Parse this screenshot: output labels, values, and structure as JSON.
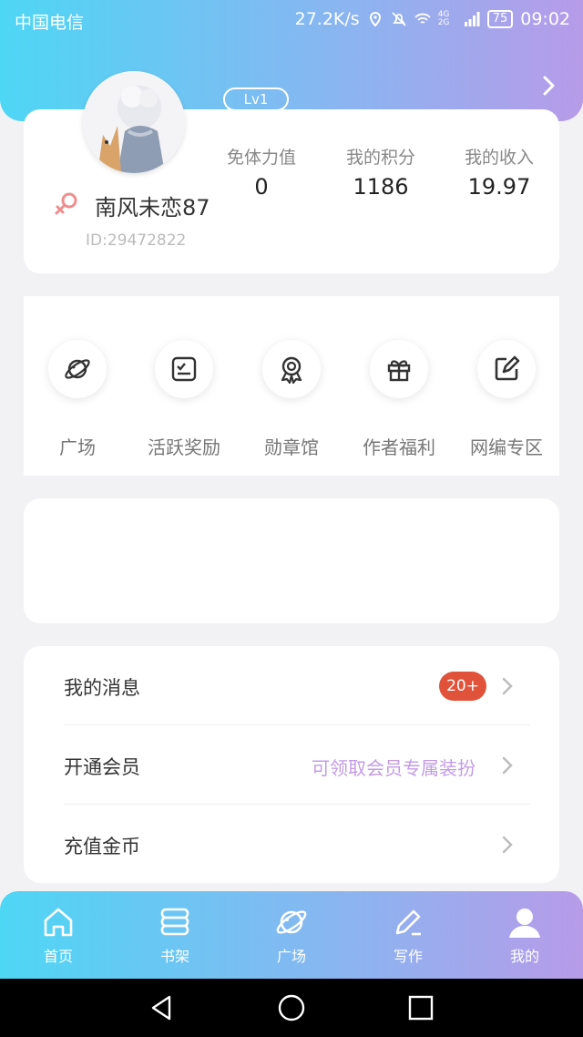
{
  "status_bar": {
    "carrier": "中国电信",
    "speed": "27.2K/s",
    "network": "4G 2G",
    "battery": "75",
    "time": "09:02"
  },
  "profile": {
    "level": "Lv1",
    "username": "南风未恋87",
    "user_id": "ID:29472822",
    "stats": [
      {
        "label": "免体力值",
        "value": "0"
      },
      {
        "label": "我的积分",
        "value": "1186"
      },
      {
        "label": "我的收入",
        "value": "19.97"
      }
    ]
  },
  "features": [
    {
      "label": "广场",
      "icon": "planet-icon"
    },
    {
      "label": "活跃奖励",
      "icon": "checklist-icon"
    },
    {
      "label": "勋章馆",
      "icon": "medal-icon"
    },
    {
      "label": "作者福利",
      "icon": "gift-icon"
    },
    {
      "label": "网编专区",
      "icon": "edit-icon"
    }
  ],
  "menu": {
    "messages": {
      "title": "我的消息",
      "badge": "20+"
    },
    "vip": {
      "title": "开通会员",
      "hint": "可领取会员专属装扮"
    },
    "recharge": {
      "title": "充值金币"
    }
  },
  "tabbar": [
    {
      "label": "首页",
      "icon": "home-icon"
    },
    {
      "label": "书架",
      "icon": "bookshelf-icon"
    },
    {
      "label": "广场",
      "icon": "planet-icon"
    },
    {
      "label": "写作",
      "icon": "pencil-icon"
    },
    {
      "label": "我的",
      "icon": "user-icon",
      "active": true
    }
  ],
  "colors": {
    "gradient_start": "#4ed6f5",
    "gradient_end": "#b79be9",
    "badge_red": "#e0533a",
    "hint_purple": "#c39be6"
  }
}
